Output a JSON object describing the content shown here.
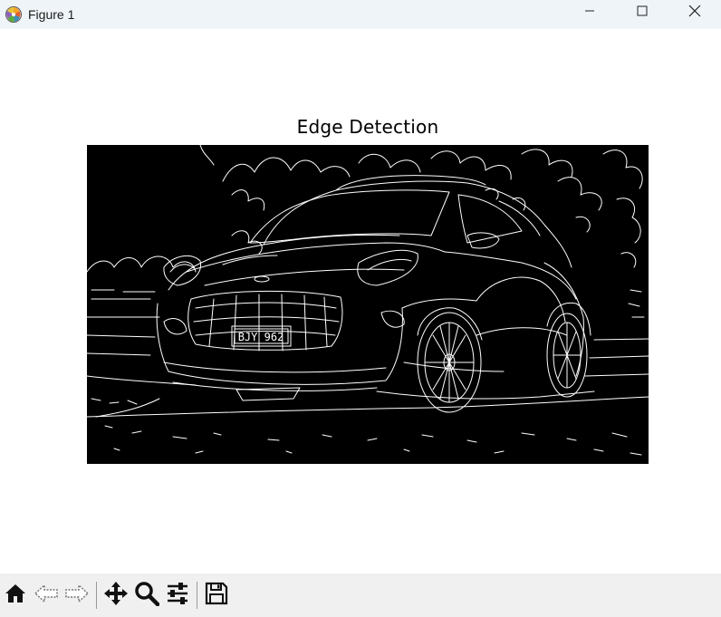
{
  "window": {
    "title": "Figure 1",
    "controls": {
      "minimize": "minimize-icon",
      "maximize": "maximize-icon",
      "close": "close-icon"
    }
  },
  "figure": {
    "title": "Edge Detection",
    "image": {
      "description_icon": "edge-detected-car-image",
      "plate_text": "BJY 962"
    }
  },
  "toolbar": {
    "buttons": [
      {
        "icon": "home-icon"
      },
      {
        "icon": "back-arrow-icon"
      },
      {
        "icon": "forward-arrow-icon"
      },
      {
        "icon": "pan-icon"
      },
      {
        "icon": "zoom-icon"
      },
      {
        "icon": "configure-subplots-icon"
      },
      {
        "icon": "save-icon"
      }
    ]
  },
  "colors": {
    "titlebar_bg": "#eff4f9",
    "toolbar_bg": "#f0f0f0",
    "image_bg": "#000000",
    "edge_stroke": "#ffffff"
  }
}
